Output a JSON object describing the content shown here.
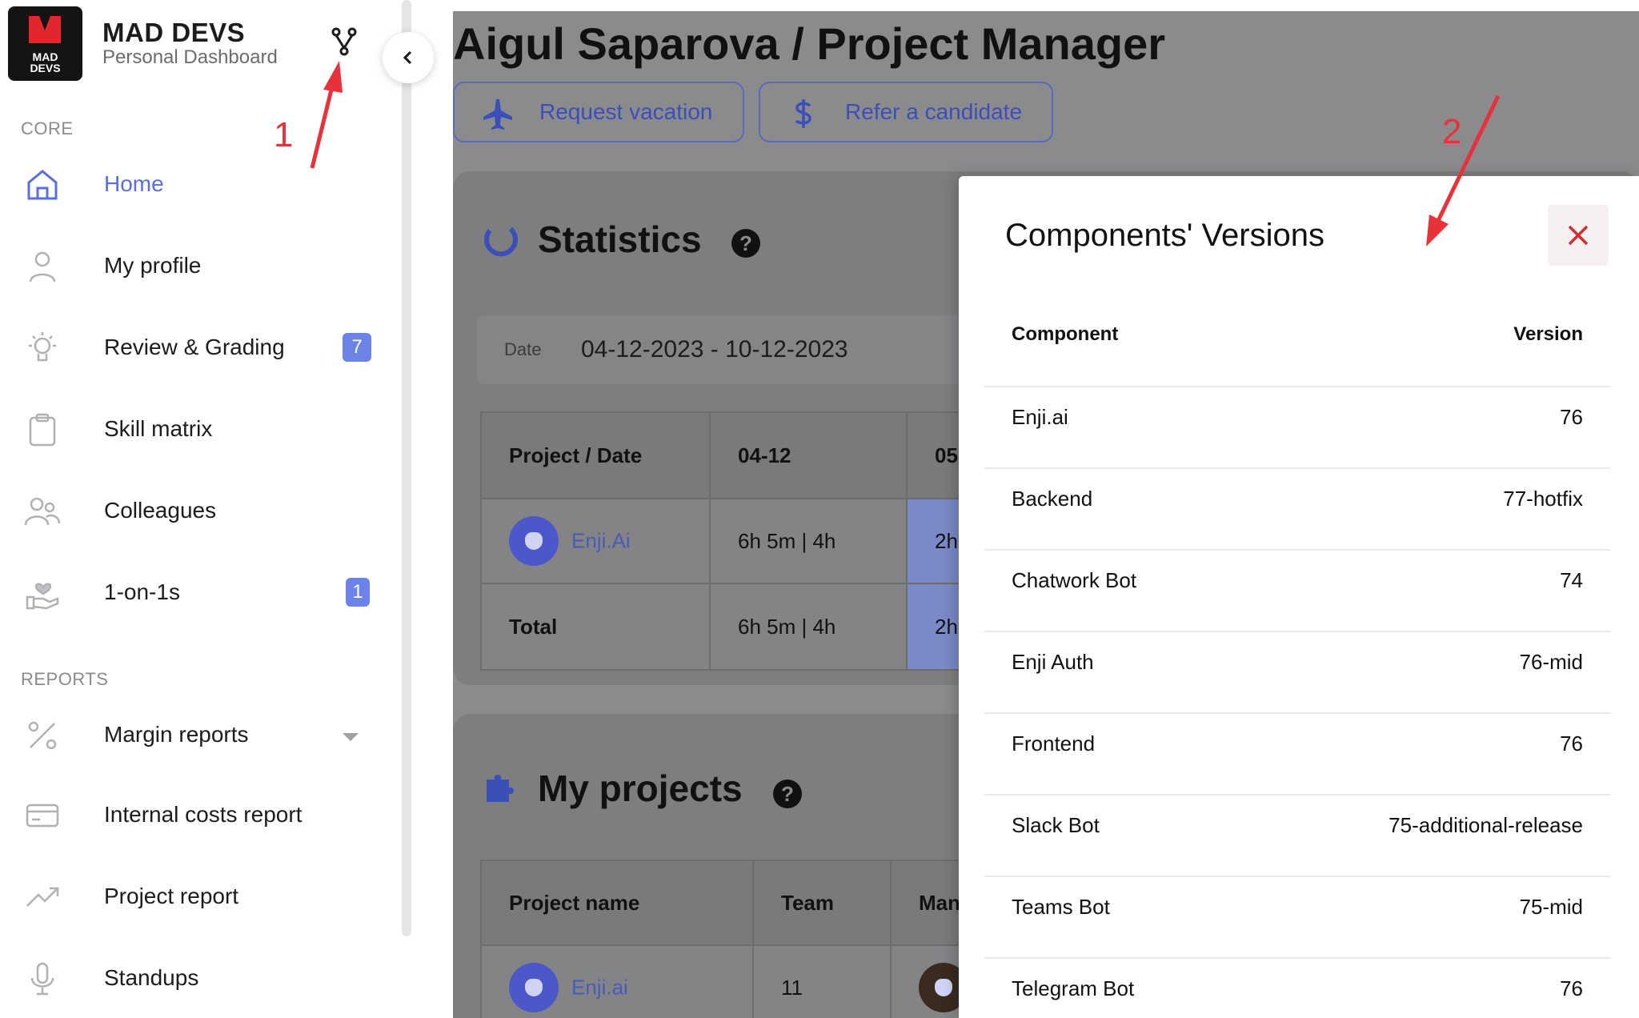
{
  "brand": {
    "logo_lines": [
      "MAD",
      "DEVS"
    ],
    "name": "MAD DEVS",
    "subtitle": "Personal Dashboard"
  },
  "sidebar": {
    "core_section": "CORE",
    "reports_section": "REPORTS",
    "items": [
      {
        "label": "Home",
        "icon": "home-icon",
        "active": true
      },
      {
        "label": "My profile",
        "icon": "user-icon"
      },
      {
        "label": "Review & Grading",
        "icon": "lightbulb-icon",
        "badge": "7"
      },
      {
        "label": "Skill matrix",
        "icon": "clipboard-icon"
      },
      {
        "label": "Colleagues",
        "icon": "users-icon"
      },
      {
        "label": "1-on-1s",
        "icon": "hand-heart-icon",
        "badge": "1"
      }
    ],
    "report_items": [
      {
        "label": "Margin reports",
        "icon": "percent-icon",
        "has_dropdown": true
      },
      {
        "label": "Internal costs report",
        "icon": "credit-card-icon"
      },
      {
        "label": "Project report",
        "icon": "trending-up-icon"
      },
      {
        "label": "Standups",
        "icon": "microphone-icon"
      }
    ]
  },
  "main": {
    "title": "Aigul Saparova / Project Manager",
    "actions": [
      {
        "label": "Request vacation",
        "icon": "airplane-icon"
      },
      {
        "label": "Refer a candidate",
        "icon": "dollar-icon"
      }
    ],
    "statistics": {
      "title": "Statistics",
      "help": "?",
      "date_label": "Date",
      "date_value": "04-12-2023 - 10-12-2023",
      "columns": [
        "Project / Date",
        "04-12",
        "05"
      ],
      "rows": [
        {
          "project": "Enji.Ai",
          "d1": "6h 5m | 4h",
          "d2": "2h"
        },
        {
          "project": "Total",
          "d1": "6h 5m | 4h",
          "d2": "2h"
        }
      ]
    },
    "projects": {
      "title": "My projects",
      "help": "?",
      "columns": [
        "Project name",
        "Team",
        "Man"
      ],
      "rows": [
        {
          "name": "Enji.ai",
          "team": "11"
        }
      ]
    }
  },
  "modal": {
    "title": "Components' Versions",
    "col_component": "Component",
    "col_version": "Version",
    "rows": [
      {
        "component": "Enji.ai",
        "version": "76"
      },
      {
        "component": "Backend",
        "version": "77-hotfix"
      },
      {
        "component": "Chatwork Bot",
        "version": "74"
      },
      {
        "component": "Enji Auth",
        "version": "76-mid"
      },
      {
        "component": "Frontend",
        "version": "76"
      },
      {
        "component": "Slack Bot",
        "version": "75-additional-release"
      },
      {
        "component": "Teams Bot",
        "version": "75-mid"
      },
      {
        "component": "Telegram Bot",
        "version": "76"
      }
    ]
  },
  "annotations": {
    "one": "1",
    "two": "2",
    "color": "#e8323a"
  },
  "colors": {
    "accent": "#5a6ee0",
    "badge": "#6b82e8",
    "close": "#d42b35"
  }
}
